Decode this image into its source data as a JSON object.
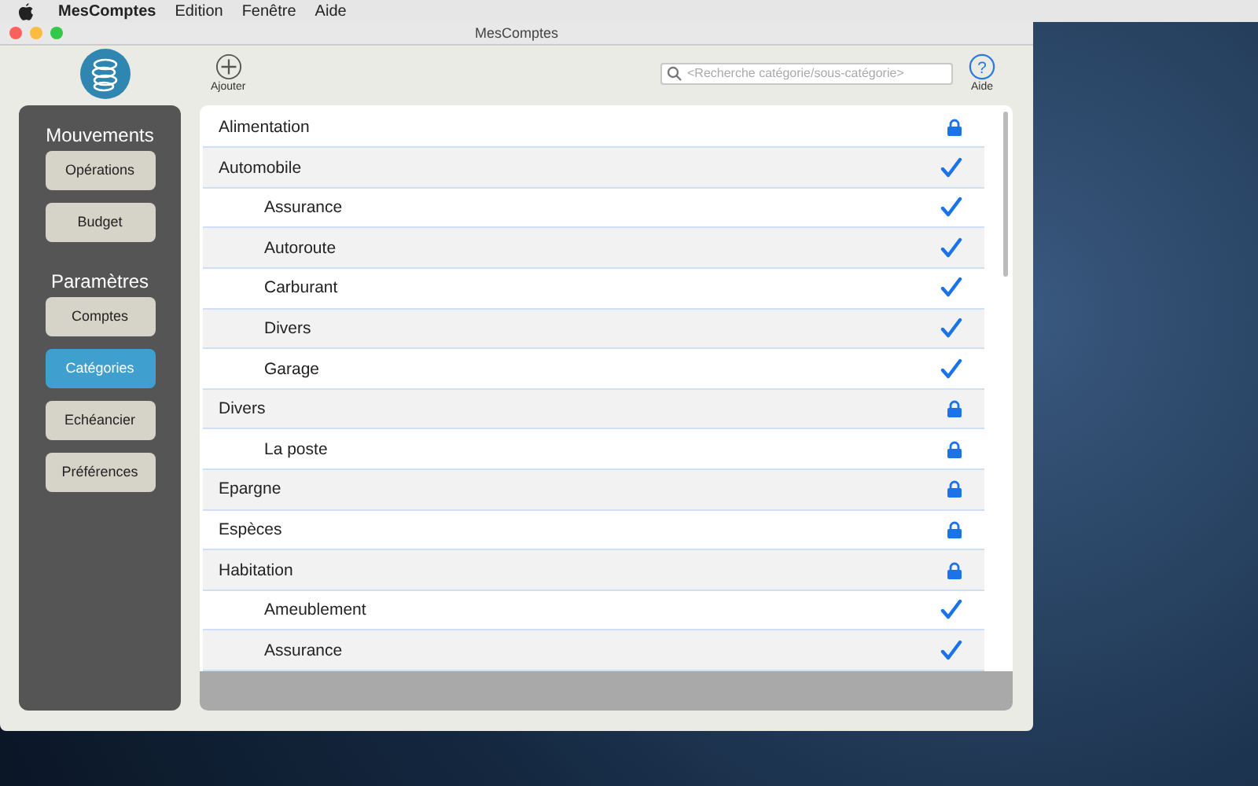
{
  "menu_bar": {
    "app_name": "MesComptes",
    "items": [
      "Edition",
      "Fenêtre",
      "Aide"
    ]
  },
  "window": {
    "title": "MesComptes"
  },
  "toolbar": {
    "add_label": "Ajouter",
    "search": {
      "placeholder": "<Recherche catégorie/sous-catégorie>"
    },
    "help_symbol": "?",
    "help_label": "Aide"
  },
  "sidebar": {
    "sections": [
      {
        "title": "Mouvements",
        "items": [
          {
            "label": "Opérations",
            "selected": false
          },
          {
            "label": "Budget",
            "selected": false
          }
        ]
      },
      {
        "title": "Paramètres",
        "items": [
          {
            "label": "Comptes",
            "selected": false
          },
          {
            "label": "Catégories",
            "selected": true
          },
          {
            "label": "Echéancier",
            "selected": false
          },
          {
            "label": "Préférences",
            "selected": false
          }
        ]
      }
    ]
  },
  "categories": [
    {
      "name": "Alimentation",
      "kind": "lock"
    },
    {
      "name": "Automobile",
      "kind": "check",
      "children": [
        {
          "name": "Assurance",
          "kind": "check"
        },
        {
          "name": "Autoroute",
          "kind": "check"
        },
        {
          "name": "Carburant",
          "kind": "check"
        },
        {
          "name": "Divers",
          "kind": "check"
        },
        {
          "name": "Garage",
          "kind": "check"
        }
      ]
    },
    {
      "name": "Divers",
      "kind": "lock",
      "children": [
        {
          "name": "La poste",
          "kind": "lock"
        }
      ]
    },
    {
      "name": "Epargne",
      "kind": "lock"
    },
    {
      "name": "Espèces",
      "kind": "lock"
    },
    {
      "name": "Habitation",
      "kind": "lock",
      "children": [
        {
          "name": "Ameublement",
          "kind": "check"
        },
        {
          "name": "Assurance",
          "kind": "check"
        }
      ]
    }
  ]
}
